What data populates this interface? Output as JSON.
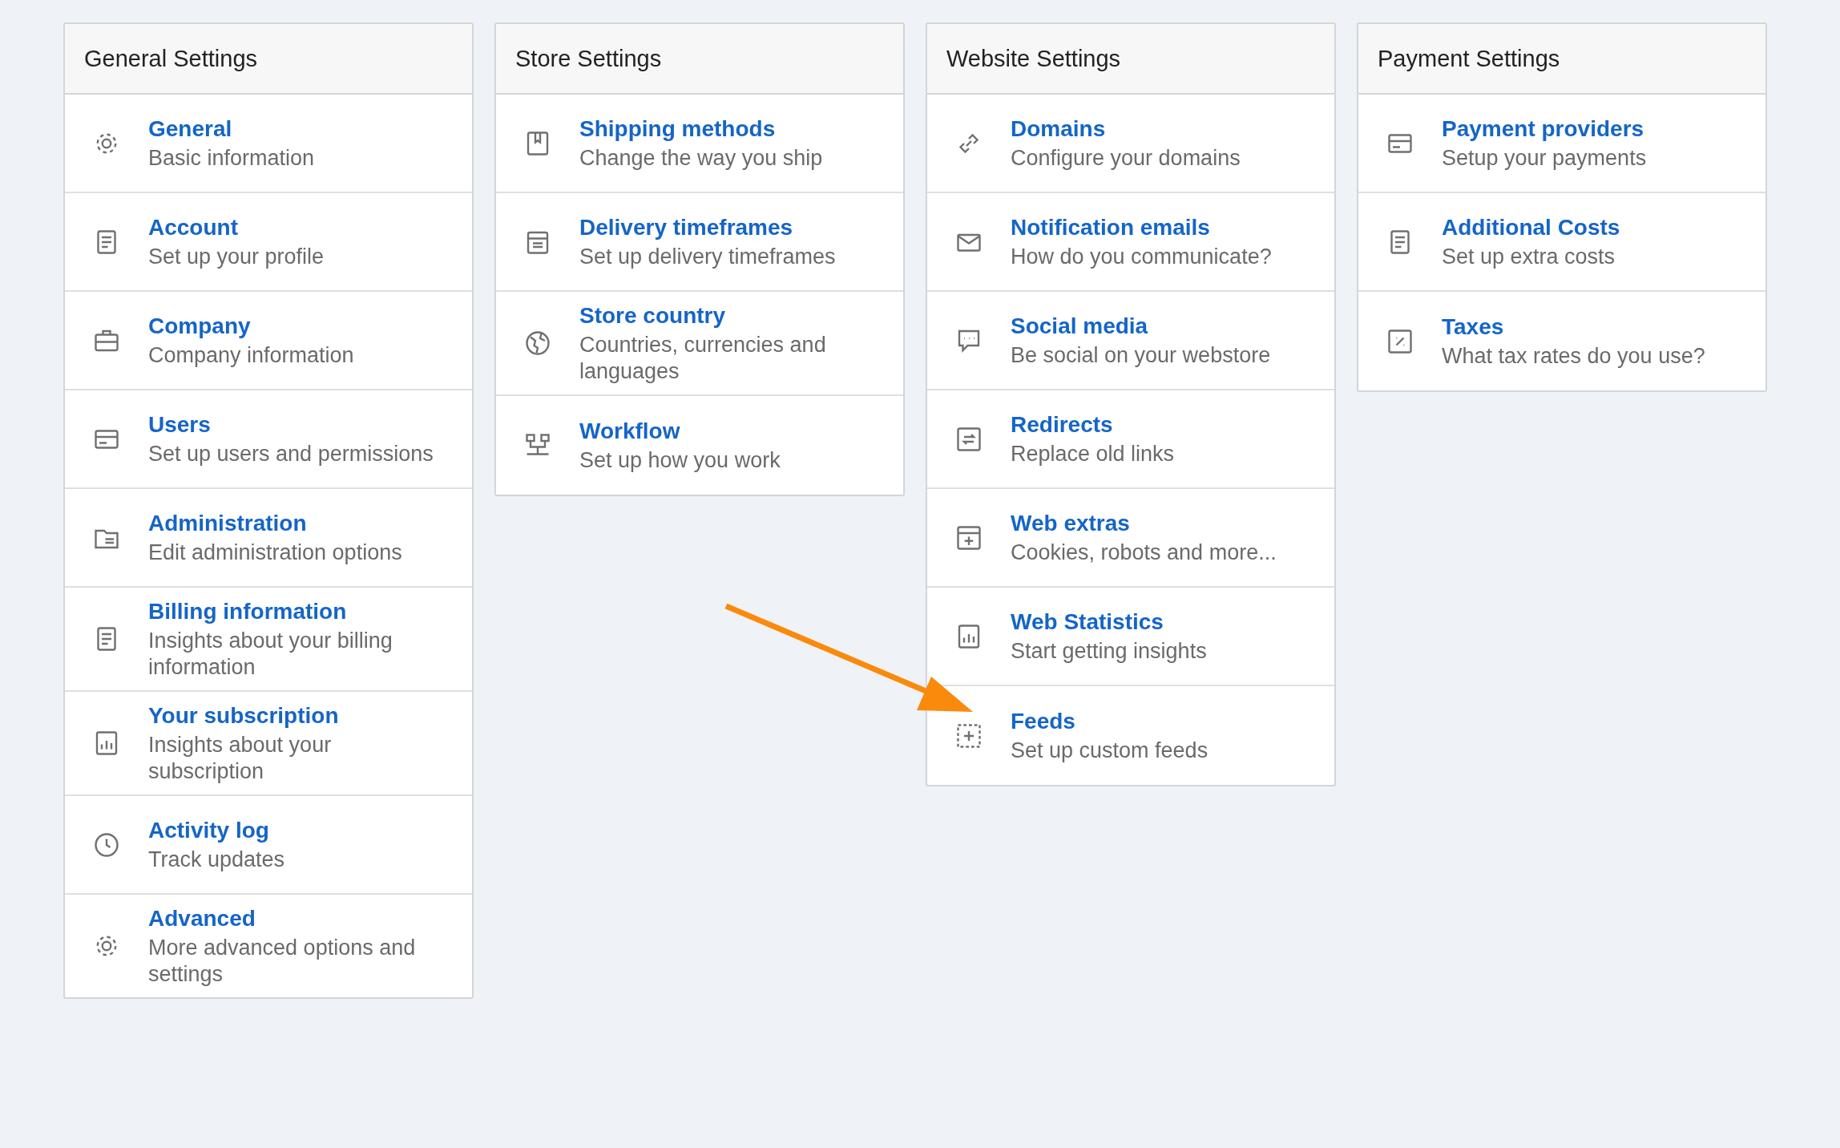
{
  "columns": [
    {
      "title": "General Settings",
      "items": [
        {
          "title": "General",
          "description": "Basic information"
        },
        {
          "title": "Account",
          "description": "Set up your profile"
        },
        {
          "title": "Company",
          "description": "Company information"
        },
        {
          "title": "Users",
          "description": "Set up users and permissions"
        },
        {
          "title": "Administration",
          "description": "Edit administration options"
        },
        {
          "title": "Billing information",
          "description": "Insights about your billing information"
        },
        {
          "title": "Your subscription",
          "description": "Insights about your subscription"
        },
        {
          "title": "Activity log",
          "description": "Track updates"
        },
        {
          "title": "Advanced",
          "description": "More advanced options and settings"
        }
      ]
    },
    {
      "title": "Store Settings",
      "items": [
        {
          "title": "Shipping methods",
          "description": "Change the way you ship"
        },
        {
          "title": "Delivery timeframes",
          "description": "Set up delivery timeframes"
        },
        {
          "title": "Store country",
          "description": "Countries, currencies and languages"
        },
        {
          "title": "Workflow",
          "description": "Set up how you work"
        }
      ]
    },
    {
      "title": "Website Settings",
      "items": [
        {
          "title": "Domains",
          "description": "Configure your domains"
        },
        {
          "title": "Notification emails",
          "description": "How do you communicate?"
        },
        {
          "title": "Social media",
          "description": "Be social on your webstore"
        },
        {
          "title": "Redirects",
          "description": "Replace old links"
        },
        {
          "title": "Web extras",
          "description": "Cookies, robots and more..."
        },
        {
          "title": "Web Statistics",
          "description": "Start getting insights"
        },
        {
          "title": "Feeds",
          "description": "Set up custom feeds"
        }
      ]
    },
    {
      "title": "Payment Settings",
      "items": [
        {
          "title": "Payment providers",
          "description": "Setup your payments"
        },
        {
          "title": "Additional Costs",
          "description": "Set up extra costs"
        },
        {
          "title": "Taxes",
          "description": "What tax rates do you use?"
        }
      ]
    }
  ]
}
